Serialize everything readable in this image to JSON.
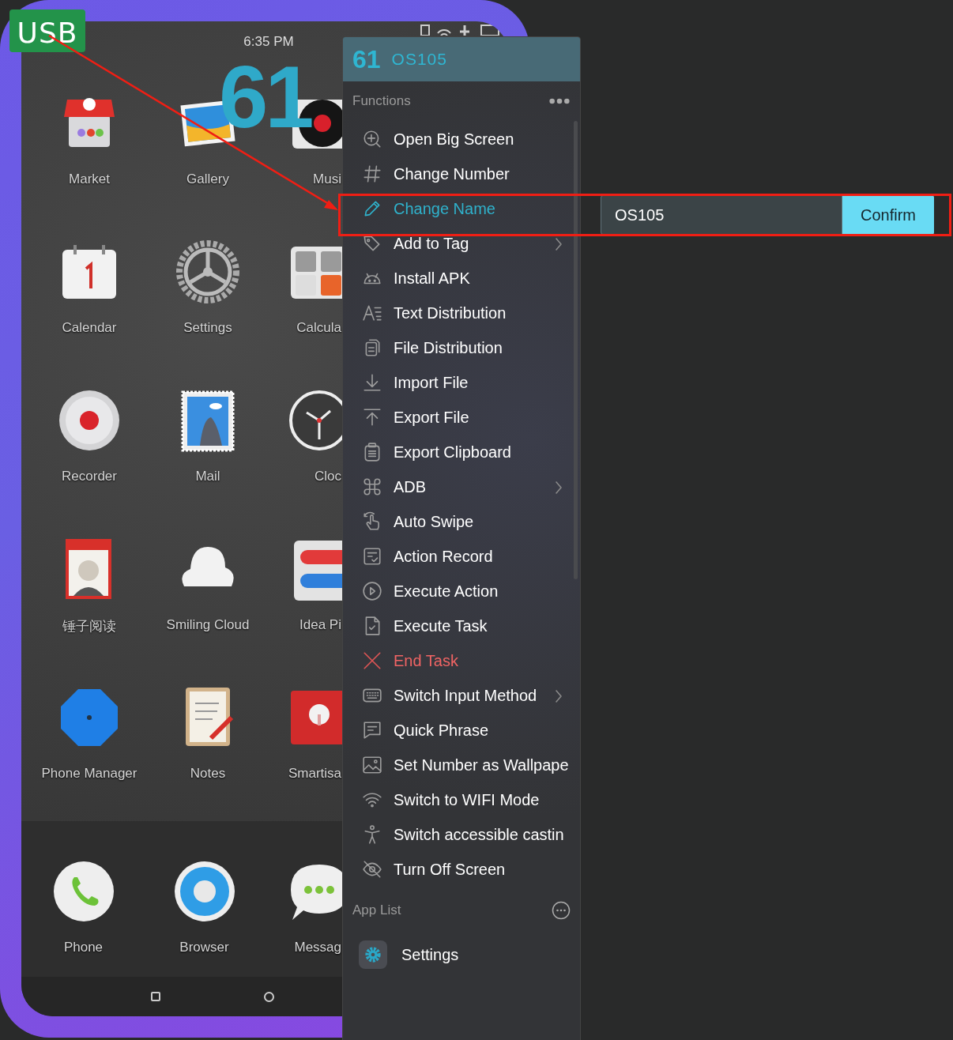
{
  "usb_badge": "USB",
  "phone": {
    "status_time": "6:35 PM",
    "number_overlay": "61",
    "apps": [
      {
        "label": "Market"
      },
      {
        "label": "Gallery"
      },
      {
        "label": "Musi"
      },
      {
        "label": "Calendar"
      },
      {
        "label": "Settings"
      },
      {
        "label": "Calcula"
      },
      {
        "label": "Recorder"
      },
      {
        "label": "Mail"
      },
      {
        "label": "Cloc"
      },
      {
        "label": "锤子阅读"
      },
      {
        "label": "Smiling Cloud"
      },
      {
        "label": "Idea Pi"
      },
      {
        "label": "Phone Manager"
      },
      {
        "label": "Notes"
      },
      {
        "label": "Smartisa"
      }
    ],
    "dock": [
      {
        "label": "Phone"
      },
      {
        "label": "Browser"
      },
      {
        "label": "Messag"
      }
    ]
  },
  "menu": {
    "number": "61",
    "name": "OS105",
    "functions_title": "Functions",
    "items": [
      {
        "label": "Open Big Screen",
        "kind": "normal",
        "selected": false,
        "submenu": false
      },
      {
        "label": "Change Number",
        "kind": "normal",
        "selected": false,
        "submenu": false
      },
      {
        "label": "Change Name",
        "kind": "normal",
        "selected": true,
        "submenu": false
      },
      {
        "label": "Add to Tag",
        "kind": "normal",
        "selected": false,
        "submenu": true
      },
      {
        "label": "Install APK",
        "kind": "normal",
        "selected": false,
        "submenu": false
      },
      {
        "label": "Text Distribution",
        "kind": "normal",
        "selected": false,
        "submenu": false
      },
      {
        "label": "File Distribution",
        "kind": "normal",
        "selected": false,
        "submenu": false
      },
      {
        "label": "Import File",
        "kind": "normal",
        "selected": false,
        "submenu": false
      },
      {
        "label": "Export File",
        "kind": "normal",
        "selected": false,
        "submenu": false
      },
      {
        "label": "Export Clipboard",
        "kind": "normal",
        "selected": false,
        "submenu": false
      },
      {
        "label": "ADB",
        "kind": "normal",
        "selected": false,
        "submenu": true
      },
      {
        "label": "Auto Swipe",
        "kind": "normal",
        "selected": false,
        "submenu": false
      },
      {
        "label": "Action Record",
        "kind": "normal",
        "selected": false,
        "submenu": false
      },
      {
        "label": "Execute Action",
        "kind": "normal",
        "selected": false,
        "submenu": false
      },
      {
        "label": "Execute Task",
        "kind": "normal",
        "selected": false,
        "submenu": false
      },
      {
        "label": "End Task",
        "kind": "danger",
        "selected": false,
        "submenu": false
      },
      {
        "label": "Switch Input Method",
        "kind": "normal",
        "selected": false,
        "submenu": true
      },
      {
        "label": "Quick Phrase",
        "kind": "normal",
        "selected": false,
        "submenu": false
      },
      {
        "label": "Set Number as Wallpape",
        "kind": "normal",
        "selected": false,
        "submenu": false
      },
      {
        "label": "Switch to WIFI Mode",
        "kind": "normal",
        "selected": false,
        "submenu": false
      },
      {
        "label": "Switch accessible castin",
        "kind": "normal",
        "selected": false,
        "submenu": false
      },
      {
        "label": "Turn Off Screen",
        "kind": "normal",
        "selected": false,
        "submenu": false
      }
    ],
    "app_list_title": "App List",
    "apps": [
      {
        "label": "Settings"
      }
    ]
  },
  "rename_popup": {
    "value": "OS105",
    "confirm": "Confirm"
  }
}
